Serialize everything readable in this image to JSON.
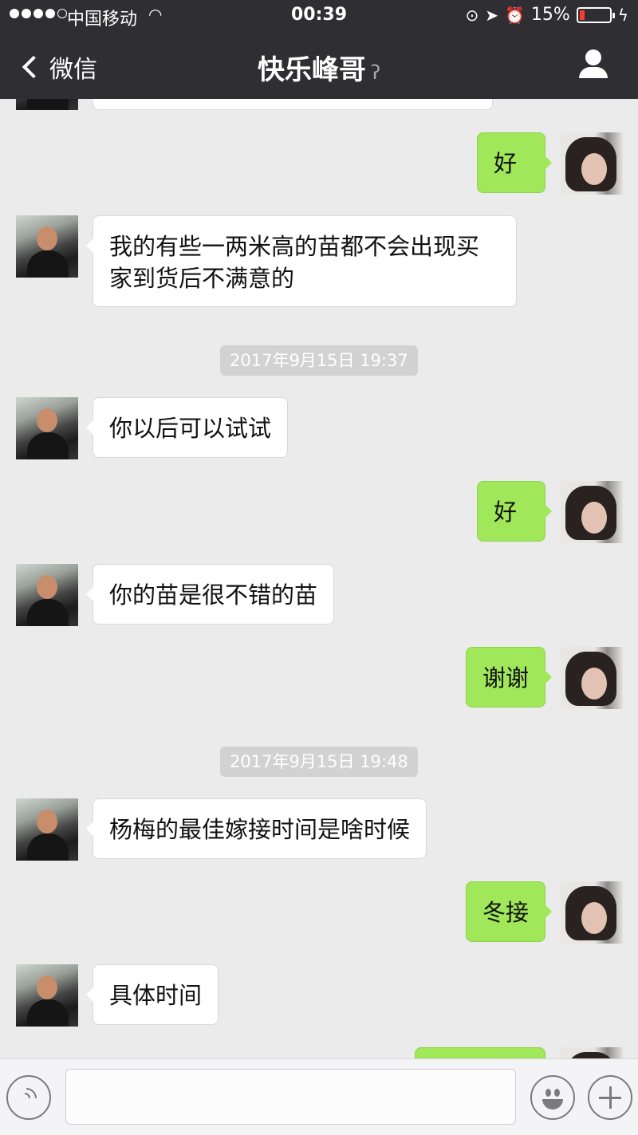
{
  "status_bar": {
    "carrier": "中国移动",
    "time": "00:39",
    "battery_percent": "15%",
    "battery_level": 0.15,
    "signal_bars": 4,
    "icons": [
      "wifi-icon",
      "rotation-lock-icon",
      "location-icon",
      "alarm-icon",
      "charging-icon"
    ]
  },
  "nav": {
    "back_label": "微信",
    "title": "快乐峰哥",
    "title_icon": "ear-icon",
    "profile_icon": "person-icon"
  },
  "messages": [
    {
      "side": "in",
      "text": ""
    },
    {
      "side": "out",
      "text": "好"
    },
    {
      "side": "in",
      "text": "我的有些一两米高的苗都不会出现买家到货后不满意的"
    },
    {
      "timestamp": "2017年9月15日 19:37"
    },
    {
      "side": "in",
      "text": "你以后可以试试"
    },
    {
      "side": "out",
      "text": "好"
    },
    {
      "side": "in",
      "text": "你的苗是很不错的苗"
    },
    {
      "side": "out",
      "text": "谢谢"
    },
    {
      "timestamp": "2017年9月15日 19:48"
    },
    {
      "side": "in",
      "text": "杨梅的最佳嫁接时间是啥时候"
    },
    {
      "side": "out",
      "text": "冬接"
    },
    {
      "side": "in",
      "text": "具体时间"
    },
    {
      "side": "out",
      "text": ""
    }
  ],
  "input_bar": {
    "voice_icon": "voice-icon",
    "input_value": "",
    "emoji_icon": "emoji-icon",
    "plus_icon": "plus-icon"
  },
  "colors": {
    "bar_bg": "#2e2e33",
    "chat_bg": "#ebebeb",
    "out_bubble": "#a0e75a",
    "in_bubble": "#ffffff",
    "timestamp_bg": "#d2d2d2",
    "battery_low": "#ff3b30"
  }
}
